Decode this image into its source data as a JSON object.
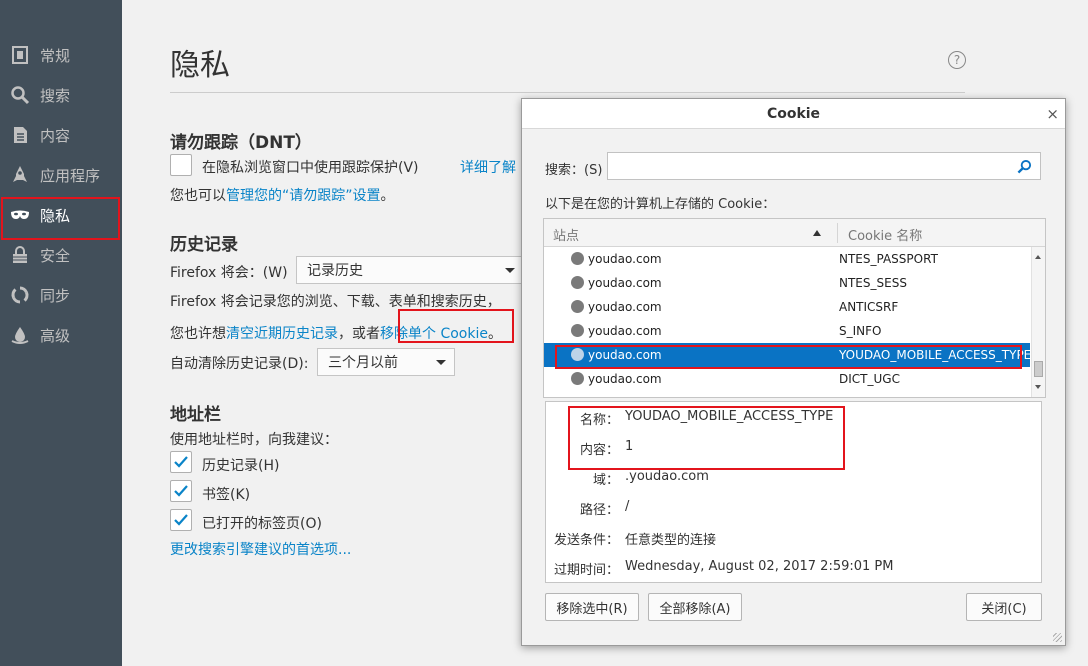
{
  "colors": {
    "sidebar_bg": "#424f5a",
    "accent": "#0a84c8",
    "selection": "#0a73c4",
    "highlight_box": "#e3141c"
  },
  "sidebar": {
    "items": [
      {
        "label": "常规",
        "icon": "general-icon"
      },
      {
        "label": "搜索",
        "icon": "search-icon"
      },
      {
        "label": "内容",
        "icon": "content-icon"
      },
      {
        "label": "应用程序",
        "icon": "applications-icon"
      },
      {
        "label": "隐私",
        "icon": "privacy-mask-icon",
        "active": true
      },
      {
        "label": "安全",
        "icon": "security-icon"
      },
      {
        "label": "同步",
        "icon": "sync-icon"
      },
      {
        "label": "高级",
        "icon": "advanced-icon"
      }
    ]
  },
  "main": {
    "title": "隐私",
    "help": "?",
    "dnt": {
      "heading": "请勿跟踪（DNT）",
      "checkbox_label": "在隐私浏览窗口中使用跟踪保护(V)",
      "learn_more": "详细了解",
      "also_prefix": "您也可以",
      "manage_link": "管理您的“请勿跟踪”设置",
      "also_suffix": "。"
    },
    "history": {
      "heading": "历史记录",
      "firefox_will": "Firefox 将会：(W)",
      "mode_value": "记录历史",
      "description": "Firefox 将会记录您的浏览、下载、表单和搜索历史，",
      "clear_prefix": "您也许想",
      "clear_link": "清空近期历史记录",
      "clear_mid": "，或者",
      "remove_link": "移除单个 Cookie",
      "clear_suffix": "。",
      "auto_clear_label": "自动清除历史记录(D):",
      "auto_clear_value": "三个月以前"
    },
    "address_bar": {
      "heading": "地址栏",
      "suggest_label": "使用地址栏时，向我建议：",
      "options": [
        {
          "label": "历史记录(H)",
          "checked": true
        },
        {
          "label": "书签(K)",
          "checked": true
        },
        {
          "label": "已打开的标签页(O)",
          "checked": true
        }
      ],
      "change_link": "更改搜索引擎建议的首选项..."
    }
  },
  "dialog": {
    "title": "Cookie",
    "close": "×",
    "search_label": "搜索：(S)",
    "search_value": "",
    "list_caption": "以下是在您的计算机上存储的 Cookie：",
    "columns": [
      "站点",
      "Cookie 名称"
    ],
    "rows": [
      {
        "site": "youdao.com",
        "name": "NTES_PASSPORT"
      },
      {
        "site": "youdao.com",
        "name": "NTES_SESS"
      },
      {
        "site": "youdao.com",
        "name": "ANTICSRF"
      },
      {
        "site": "youdao.com",
        "name": "S_INFO"
      },
      {
        "site": "youdao.com",
        "name": "YOUDAO_MOBILE_ACCESS_TYPE",
        "selected": true
      },
      {
        "site": "youdao.com",
        "name": "DICT_UGC"
      }
    ],
    "details": [
      {
        "label": "名称：",
        "value": "YOUDAO_MOBILE_ACCESS_TYPE"
      },
      {
        "label": "内容：",
        "value": "1"
      },
      {
        "label": "域：",
        "value": ".youdao.com"
      },
      {
        "label": "路径：",
        "value": "/"
      },
      {
        "label": "发送条件：",
        "value": "任意类型的连接"
      },
      {
        "label": "过期时间：",
        "value": "Wednesday, August 02, 2017 2:59:01 PM"
      }
    ],
    "buttons": {
      "remove_selected": "移除选中(R)",
      "remove_all": "全部移除(A)",
      "close": "关闭(C)"
    }
  }
}
